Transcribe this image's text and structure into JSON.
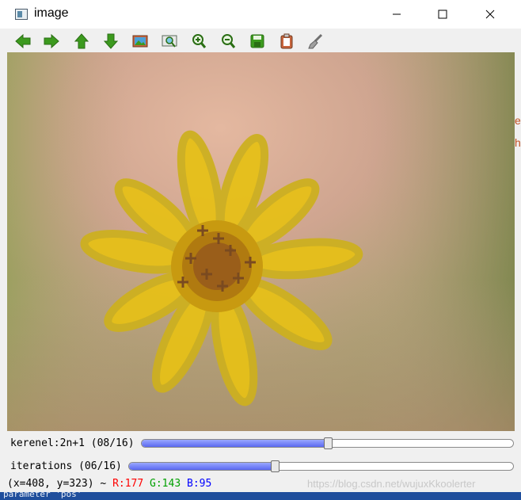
{
  "window": {
    "title": "image"
  },
  "toolbar": {
    "buttons": [
      "arrow-left",
      "arrow-right",
      "arrow-up",
      "arrow-down",
      "image",
      "zoom-region",
      "zoom-in",
      "zoom-out",
      "save",
      "copy",
      "properties"
    ]
  },
  "trackbars": [
    {
      "label": "kerenel:2n+1 (08/16)",
      "value": 8,
      "max": 16
    },
    {
      "label": "iterations (06/16)",
      "value": 6,
      "max": 16
    }
  ],
  "status": {
    "coords": "(x=408, y=323) ~",
    "r": "R:177",
    "g": "G:143",
    "b": "B:95"
  },
  "watermark": "https://blog.csdn.net/wujuxKkoolerter",
  "background_text": {
    "bottom": "parameter 'pos'",
    "right_1": "e",
    "right_2": "h"
  },
  "colors": {
    "r": "#ff0000",
    "g": "#00a000",
    "b": "#0000ff",
    "slider_fill": "#6a78f2",
    "bottom_bar": "#1f4e9c"
  }
}
